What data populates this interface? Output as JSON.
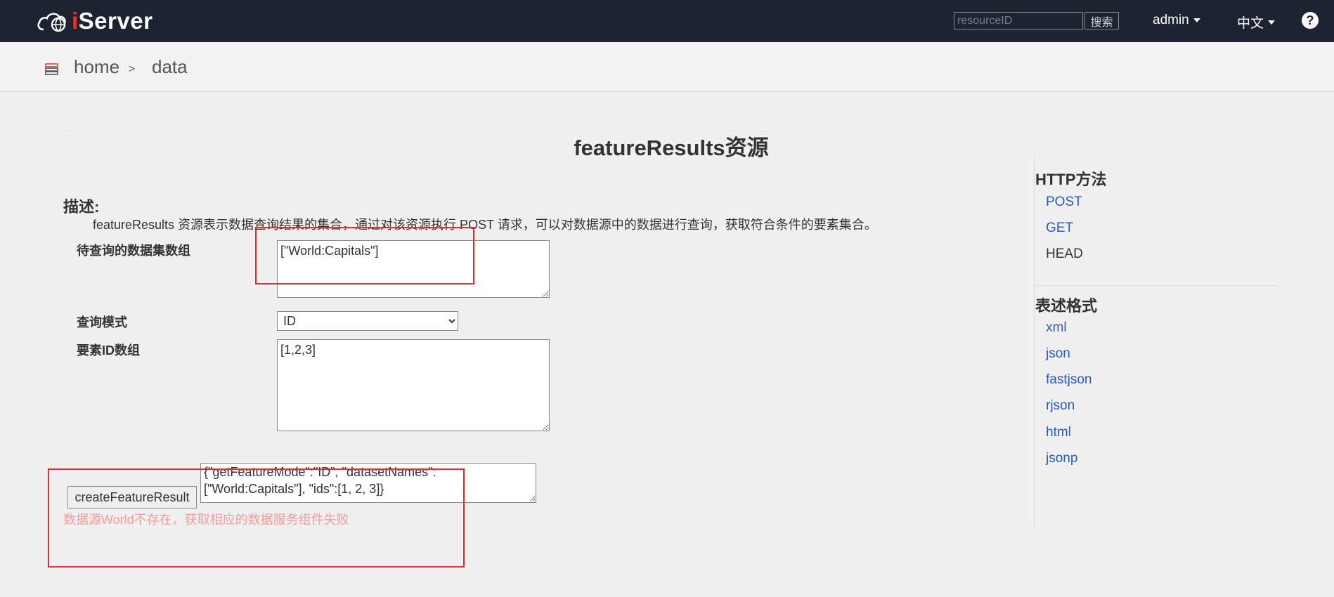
{
  "header": {
    "logo_text": "Server",
    "logo_prefix": "i",
    "search_placeholder": "resourceID",
    "search_button": "搜索",
    "user_menu": "admin",
    "language_menu": "中文",
    "help": "?"
  },
  "breadcrumb": {
    "home": "home",
    "separator": ">",
    "current": "data"
  },
  "main": {
    "title": "featureResults资源",
    "description_label": "描述:",
    "description_text": "featureResults 资源表示数据查询结果的集合，通过对该资源执行 POST 请求，可以对数据源中的数据进行查询，获取符合条件的要素集合。",
    "fields": {
      "dataset_label": "待查询的数据集数组",
      "dataset_value": "[\"World:Capitals\"]",
      "mode_label": "查询模式",
      "mode_value": "ID",
      "ids_label": "要素ID数组",
      "ids_value": "[1,2,3]"
    },
    "create_button": "createFeatureResult",
    "request_body": "{\"getFeatureMode\":\"ID\", \"datasetNames\":[\"World:Capitals\"], \"ids\":[1, 2, 3]}",
    "error_message": "数据源World不存在，获取相应的数据服务组件失败"
  },
  "sidebar": {
    "http_heading": "HTTP方法",
    "http_methods": [
      "POST",
      "GET",
      "HEAD"
    ],
    "format_heading": "表述格式",
    "formats": [
      "xml",
      "json",
      "fastjson",
      "rjson",
      "html",
      "jsonp"
    ]
  },
  "colors": {
    "navbar_bg": "#1b2430",
    "link": "#2b5bb5",
    "error": "#f29c9c",
    "annotation_box": "#e52b2b"
  }
}
